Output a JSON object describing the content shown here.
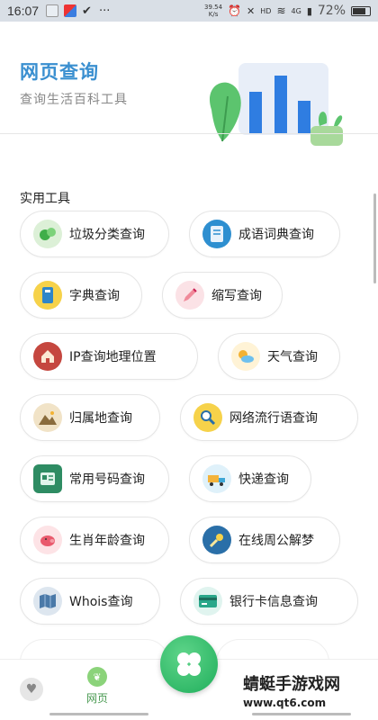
{
  "status_bar": {
    "time": "16:07",
    "dots": "···",
    "speed": "39.54",
    "speed_unit": "K/s",
    "hd": "HD",
    "network": "4G",
    "battery": "72%"
  },
  "header": {
    "title": "网页查询",
    "subtitle": "查询生活百科工具"
  },
  "section": {
    "title": "实用工具"
  },
  "tools": [
    {
      "label": "垃圾分类查询",
      "icon": "recycle-icon",
      "color": "#3fae49"
    },
    {
      "label": "成语词典查询",
      "icon": "book-icon",
      "color": "#2e8fd0"
    },
    {
      "label": "字典查询",
      "icon": "dictionary-icon",
      "color": "#2f86c9"
    },
    {
      "label": "缩写查询",
      "icon": "pencil-icon",
      "color": "#f08a9a"
    },
    {
      "label": "IP查询地理位置",
      "icon": "house-icon",
      "color": "#c5473f"
    },
    {
      "label": "天气查询",
      "icon": "weather-icon",
      "color": "#f3b233"
    },
    {
      "label": "归属地查询",
      "icon": "landscape-icon",
      "color": "#8a6c3d"
    },
    {
      "label": "网络流行语查询",
      "icon": "magnifier-icon",
      "color": "#f2b632"
    },
    {
      "label": "常用号码查询",
      "icon": "phonebook-icon",
      "color": "#2e8c63"
    },
    {
      "label": "快递查询",
      "icon": "truck-icon",
      "color": "#3fa7d6"
    },
    {
      "label": "生肖年龄查询",
      "icon": "pig-icon",
      "color": "#e95a6d"
    },
    {
      "label": "在线周公解梦",
      "icon": "comet-icon",
      "color": "#2a6fa8"
    },
    {
      "label": "Whois查询",
      "icon": "map-icon",
      "color": "#4a79a8"
    },
    {
      "label": "银行卡信息查询",
      "icon": "bankcard-icon",
      "color": "#2aa78a"
    }
  ],
  "bottom_nav": {
    "web_label": "网页"
  },
  "watermark": {
    "text": "蜻蜓手游戏网",
    "url": "www.qt6.com"
  }
}
